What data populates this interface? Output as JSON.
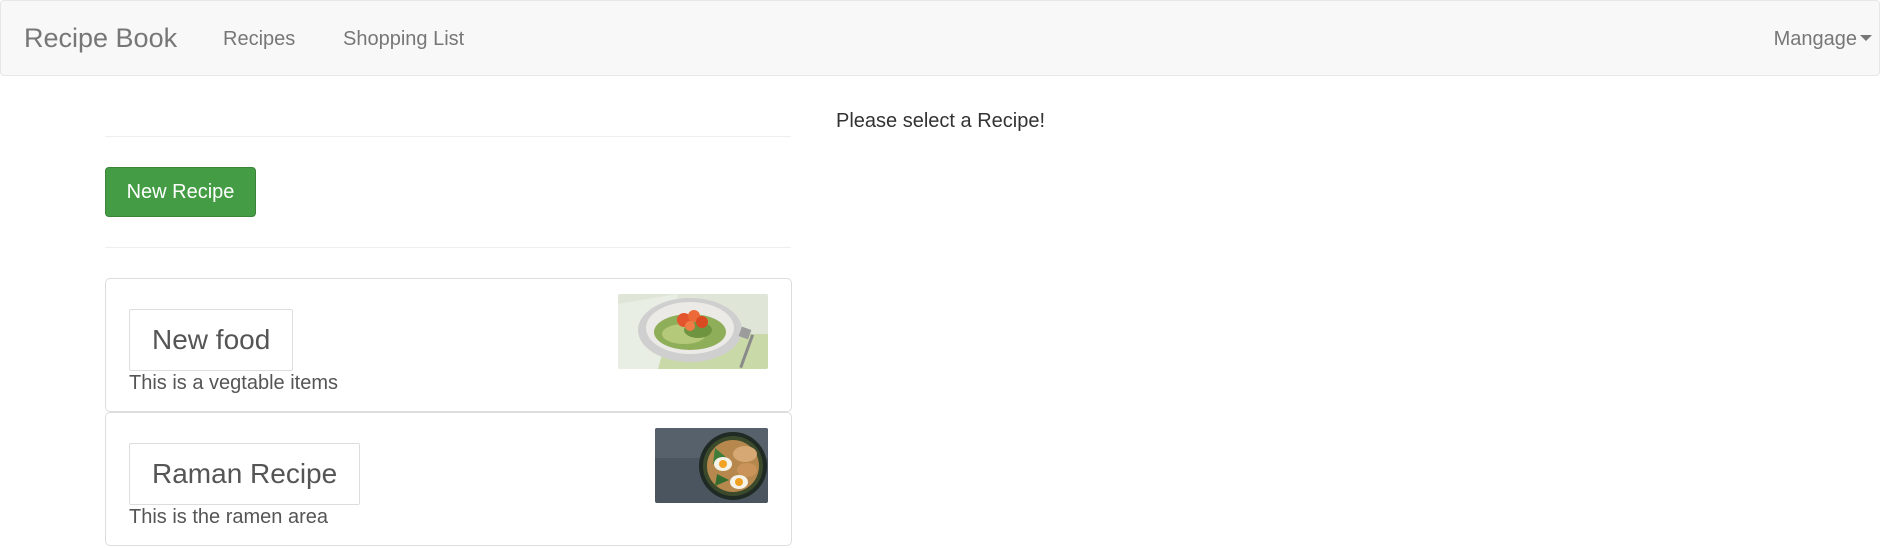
{
  "navbar": {
    "brand": "Recipe Book",
    "links": [
      {
        "label": "Recipes"
      },
      {
        "label": "Shopping List"
      }
    ],
    "manage_label": "Mangage"
  },
  "recipe_list": {
    "new_button_label": "New Recipe",
    "items": [
      {
        "name": "New food",
        "description": "This is a vegtable items",
        "image": "salad-bowl-photo"
      },
      {
        "name": "Raman Recipe",
        "description": "This is the ramen area",
        "image": "ramen-bowl-photo"
      }
    ]
  },
  "detail": {
    "placeholder_text": "Please select a Recipe!"
  },
  "colors": {
    "navbar_bg": "#f8f8f8",
    "success_button": "#449d44",
    "text_muted": "#777777"
  }
}
